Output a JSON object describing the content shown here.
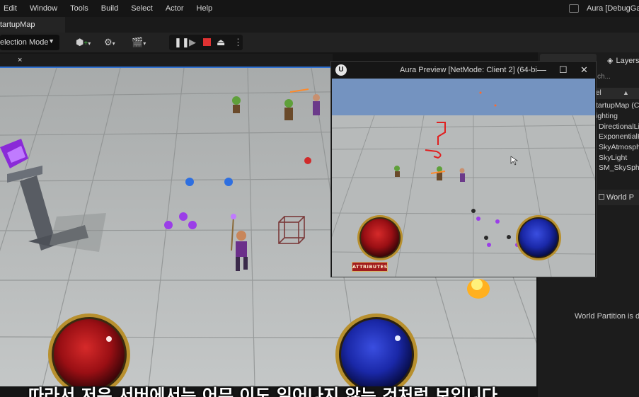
{
  "menubar": {
    "items": [
      "Edit",
      "Window",
      "Tools",
      "Build",
      "Select",
      "Actor",
      "Help"
    ],
    "app_title": "Aura [DebugGam"
  },
  "map_tab": {
    "label": "tartupMap"
  },
  "toolbar": {
    "mode_label": "election Mode",
    "icons": [
      "add-actor-icon",
      "blueprint-icon",
      "cinematics-icon",
      "pause-icon",
      "play-icon",
      "stop-icon",
      "eject-icon",
      "more-options-icon"
    ]
  },
  "viewport": {
    "close_glyph": "×"
  },
  "outliner": {
    "layers_label": "Layers",
    "search_placeholder": "ch...",
    "column_header": "el",
    "rows": [
      "tartupMap (Clie",
      "ighting",
      "DirectionalLi",
      "ExponentialH",
      "SkyAtmosph",
      "SkyLight",
      "SM_SkySphe"
    ]
  },
  "world_partition": {
    "tab_label": "World P",
    "status_text": "World Partition is dis"
  },
  "preview_window": {
    "title": "Aura Preview [NetMode: Client 2]  (64-bi",
    "minimize_glyph": "—",
    "maximize_glyph": "☐",
    "close_glyph": "✕",
    "hud_button": "ATTRIBUTES"
  },
  "colors": {
    "editor_bg": "#151515",
    "floor": "#b9bcbc",
    "health_orb": "#a3101a",
    "mana_orb": "#1a2aa8",
    "orb_rim": "#b8902e",
    "sky": "#7493c0",
    "play_stop": "#e03232"
  },
  "subtitle": {
    "text": "따라서 저은 서버에서는 어무 이도 일어나지 않는 것처럼 보입니다"
  }
}
